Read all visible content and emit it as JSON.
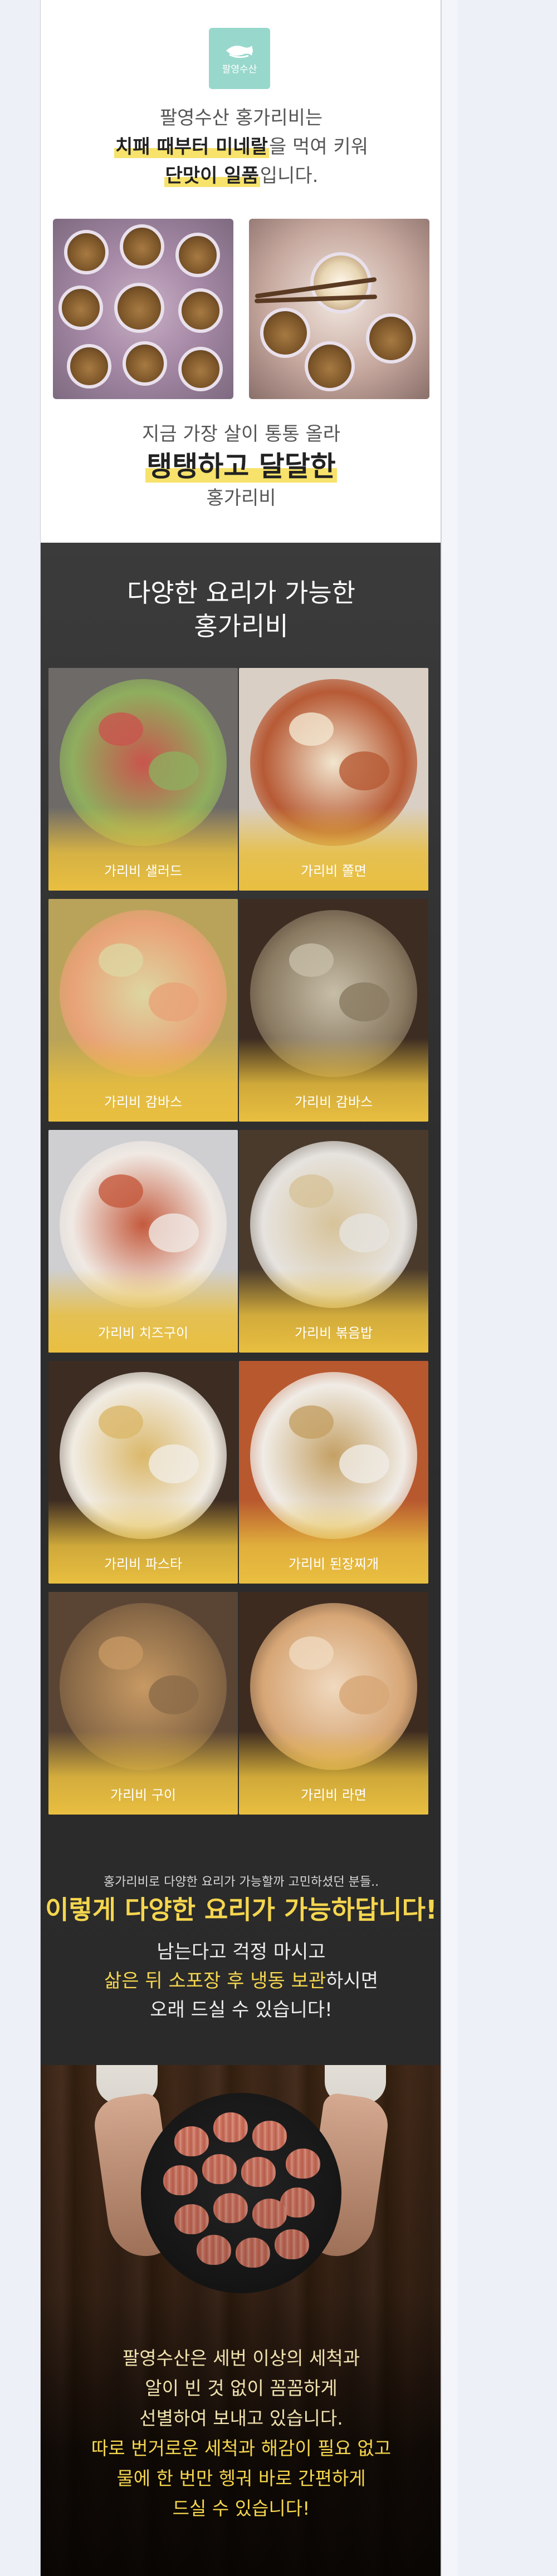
{
  "logo": {
    "text": "팔영수산",
    "icon": "fish-icon",
    "bg_color": "#98d8cc"
  },
  "intro": {
    "line1": "팔영수산 홍가리비는",
    "line2_bold": "치패 때부터 미네랄",
    "line2_tail": "을 먹여 키워",
    "line3_bold": "단맛이 일품",
    "line3_tail": "입니다.",
    "line4": "지금 가장 살이 통통 올라",
    "line5_bold": "탱탱하고 달달한",
    "line6": "홍가리비"
  },
  "dishes": {
    "title_line1": "다양한 요리가 가능한",
    "title_line2": "홍가리비",
    "items": [
      {
        "label": "가리비 샐러드"
      },
      {
        "label": "가리비 쫄면"
      },
      {
        "label": "가리비 감바스"
      },
      {
        "label": "가리비 감바스"
      },
      {
        "label": "가리비 치즈구이"
      },
      {
        "label": "가리비 볶음밥"
      },
      {
        "label": "가리비 파스타"
      },
      {
        "label": "가리비 된장찌개"
      },
      {
        "label": "가리비 구이"
      },
      {
        "label": "가리비 라면"
      }
    ],
    "note_small": "홍가리비로 다양한 요리가 가능할까 고민하셨던 분들..",
    "note_big": "이렇게 다양한 요리가 가능하답니다!",
    "note_line1": "남는다고 걱정 마시고",
    "note_line2_hl": "삶은 뒤 소포장 후 냉동 보관",
    "note_line2_tail": "하시면",
    "note_line3": "오래 드실 수 있습니다!"
  },
  "bowl": {
    "line1": "팔영수산은 세번 이상의 세척과",
    "line2": "알이 빈 것 없이 꼼꼼하게",
    "line3": "선별하여 보내고 있습니다.",
    "line4": "따로 번거로운 세척과 해감이 필요 없고",
    "line5": "물에 한 번만 헹궈 바로 간편하게",
    "line6": "드실 수 있습니다!"
  },
  "colors": {
    "accent_yellow": "#f5d64e",
    "highlight": "#f7e26b",
    "dark_bg": "#2e2e2e",
    "dish_fade": "#e9bf40"
  }
}
